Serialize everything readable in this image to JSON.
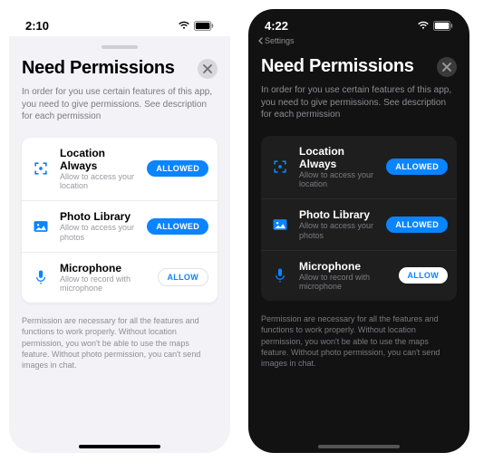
{
  "light": {
    "status": {
      "time": "2:10"
    },
    "title": "Need Permissions",
    "description": "In order for you use certain features of this app, you need to give permissions. See description for each permission",
    "permissions": [
      {
        "name": "Location Always",
        "sub": "Allow to access your location",
        "badge": "ALLOWED",
        "state": "allowed",
        "icon": "location"
      },
      {
        "name": "Photo Library",
        "sub": "Allow to access your photos",
        "badge": "ALLOWED",
        "state": "allowed",
        "icon": "photo"
      },
      {
        "name": "Microphone",
        "sub": "Allow to record with microphone",
        "badge": "ALLOW",
        "state": "allow",
        "icon": "mic"
      }
    ],
    "footnote": "Permission are necessary for all the features and functions to work properly. Without location permission, you won't be able to use the maps feature. Without photo permission, you can't send images in chat."
  },
  "dark": {
    "status": {
      "time": "4:22"
    },
    "breadcrumb": "Settings",
    "title": "Need Permissions",
    "description": "In order for you use certain features of this app, you need to give permissions. See description for each permission",
    "permissions": [
      {
        "name": "Location Always",
        "sub": "Allow to access your location",
        "badge": "ALLOWED",
        "state": "allowed",
        "icon": "location"
      },
      {
        "name": "Photo Library",
        "sub": "Allow to access your photos",
        "badge": "ALLOWED",
        "state": "allowed",
        "icon": "photo"
      },
      {
        "name": "Microphone",
        "sub": "Allow to record with microphone",
        "badge": "ALLOW",
        "state": "allow",
        "icon": "mic"
      }
    ],
    "footnote": "Permission are necessary for all the features and functions to work properly. Without location permission, you won't be able to use the maps feature. Without photo permission, you can't send images in chat."
  }
}
